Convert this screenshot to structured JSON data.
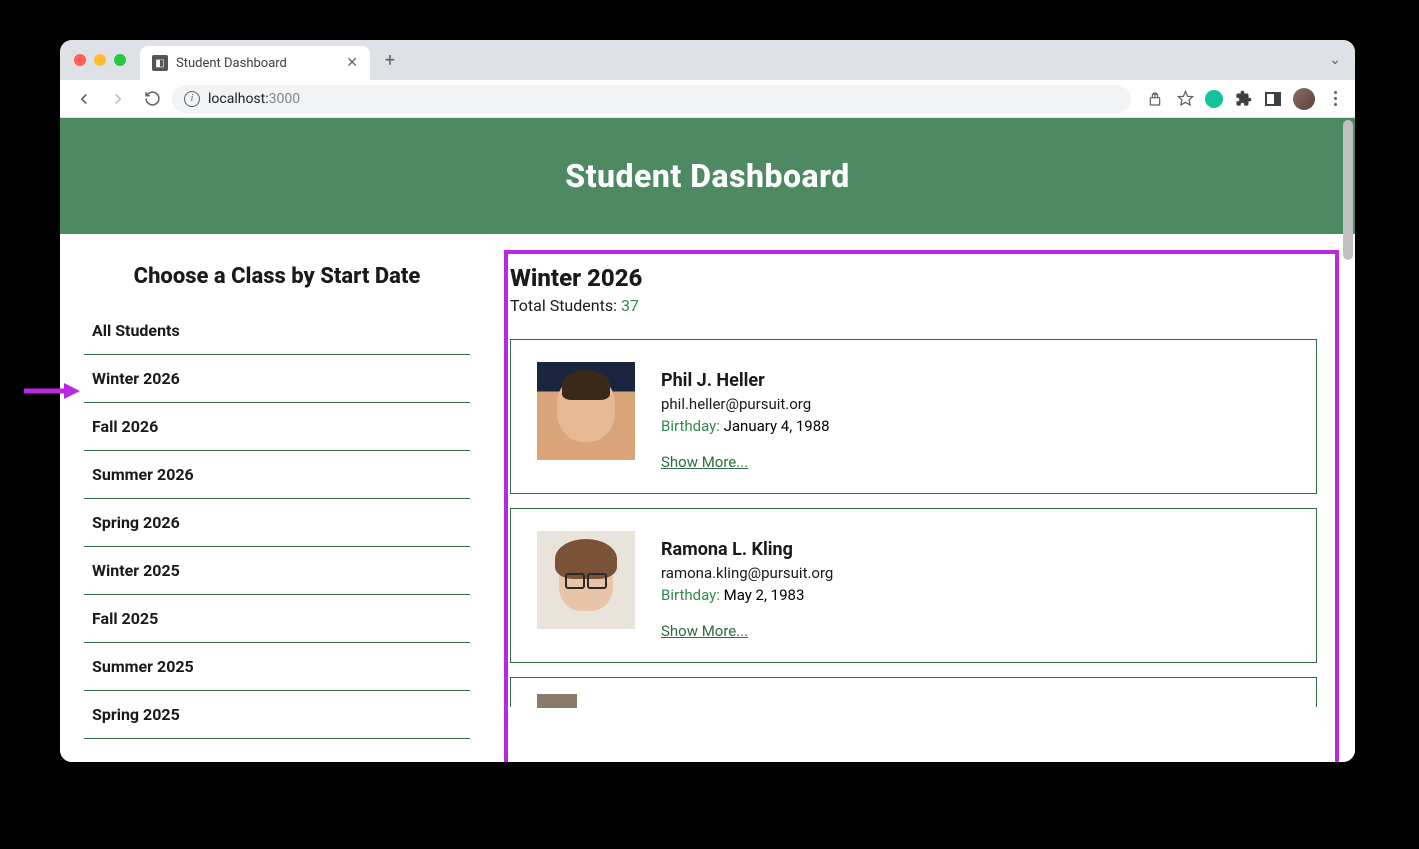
{
  "browser": {
    "tab_title": "Student Dashboard",
    "url_host": "localhost:",
    "url_port": "3000"
  },
  "header": {
    "title": "Student Dashboard"
  },
  "sidebar": {
    "heading": "Choose a Class by Start Date",
    "items": [
      "All Students",
      "Winter 2026",
      "Fall 2026",
      "Summer 2026",
      "Spring 2026",
      "Winter 2025",
      "Fall 2025",
      "Summer 2025",
      "Spring 2025"
    ]
  },
  "cohort": {
    "title": "Winter 2026",
    "total_label": "Total Students: ",
    "total_count": "37"
  },
  "students": [
    {
      "name": "Phil J. Heller",
      "email": "phil.heller@pursuit.org",
      "birthday_label": "Birthday:",
      "birthday_value": "January 4, 1988",
      "show_more": "Show More..."
    },
    {
      "name": "Ramona L. Kling",
      "email": "ramona.kling@pursuit.org",
      "birthday_label": "Birthday:",
      "birthday_value": "May 2, 1983",
      "show_more": "Show More..."
    }
  ]
}
